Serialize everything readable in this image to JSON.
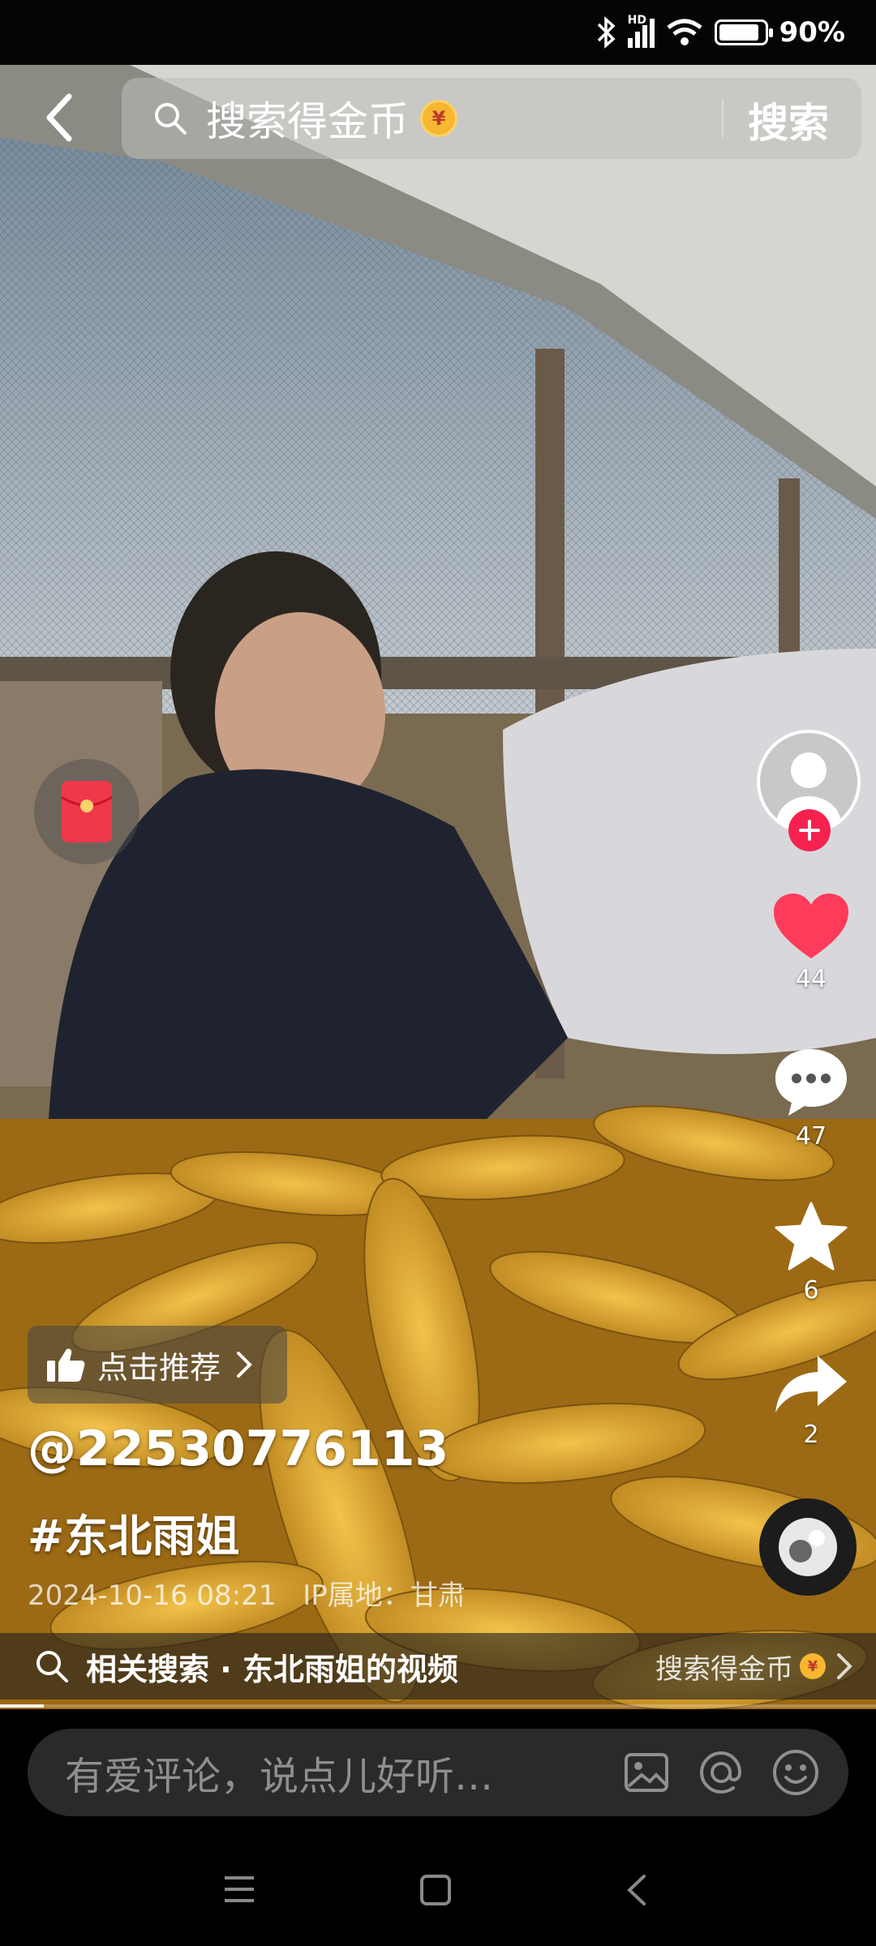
{
  "status_bar": {
    "network": "HD",
    "battery_level": 0.9,
    "battery": "90%"
  },
  "search": {
    "placeholder": "搜索得金币",
    "coin_glyph": "¥",
    "button_label": "搜索"
  },
  "actions": {
    "like_count": "44",
    "comment_count": "47",
    "favorite_count": "6",
    "share_count": "2",
    "like_color": "#ff3b5c",
    "follow_color": "#f5224f"
  },
  "video": {
    "recommend_label": "点击推荐",
    "username": "@22530776113",
    "hashtag": "#东北雨姐",
    "date": "2024-10-16 08:21",
    "ip_location": "IP属地：甘肃",
    "progress": 0.05
  },
  "related": {
    "label": "相关搜索 · 东北雨姐的视频",
    "right_label": "搜索得金币"
  },
  "comment": {
    "placeholder": "有爱评论，说点儿好听…"
  },
  "icons": [
    "back-icon",
    "search-icon",
    "coin-icon",
    "red-packet-icon",
    "avatar-icon",
    "follow-plus-icon",
    "heart-icon",
    "comment-icon",
    "star-icon",
    "share-icon",
    "music-disc-icon",
    "thumbs-up-icon",
    "image-icon",
    "at-icon",
    "emoji-icon",
    "menu-icon",
    "home-icon",
    "nav-back-icon"
  ]
}
